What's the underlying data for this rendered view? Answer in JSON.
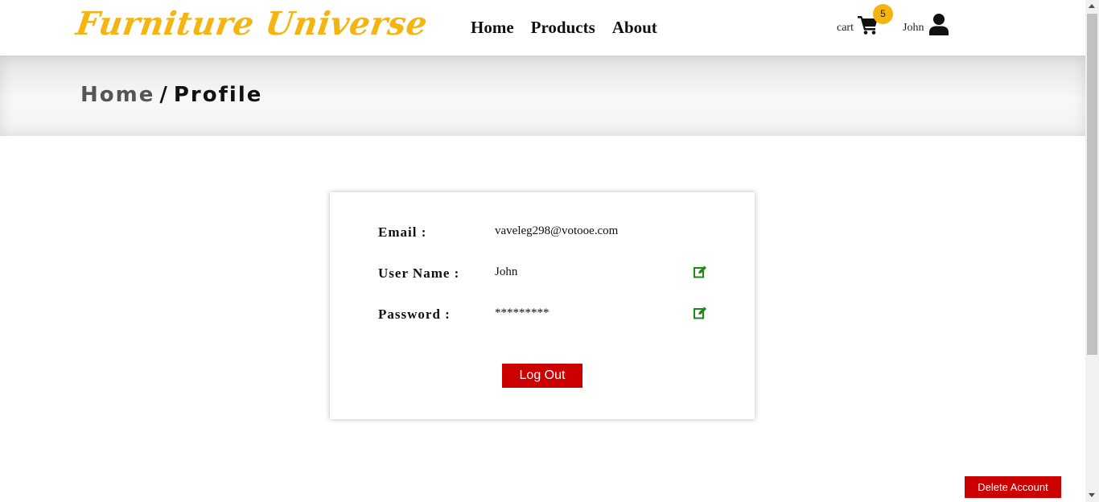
{
  "header": {
    "logo": "Furniture Universe",
    "nav": [
      "Home",
      "Products",
      "About"
    ],
    "cart_label": "cart",
    "cart_count": "5",
    "user_name": "John",
    "brand_color": "#f4b512",
    "icons": {
      "cart": "shopping-cart-icon",
      "user": "user-icon"
    }
  },
  "breadcrumb": {
    "home": "Home",
    "separator": "/",
    "current": "Profile"
  },
  "profile": {
    "email_label": "Email :",
    "email_value": "vaveleg298@votooe.com",
    "username_label": "User Name :",
    "username_value": "John",
    "password_label": "Password :",
    "password_value": "*********",
    "edit_icon": "edit-icon",
    "edit_icon_color": "#1a8a1a"
  },
  "buttons": {
    "logout": "Log Out",
    "delete_account": "Delete Account",
    "color": "#cc0000"
  }
}
